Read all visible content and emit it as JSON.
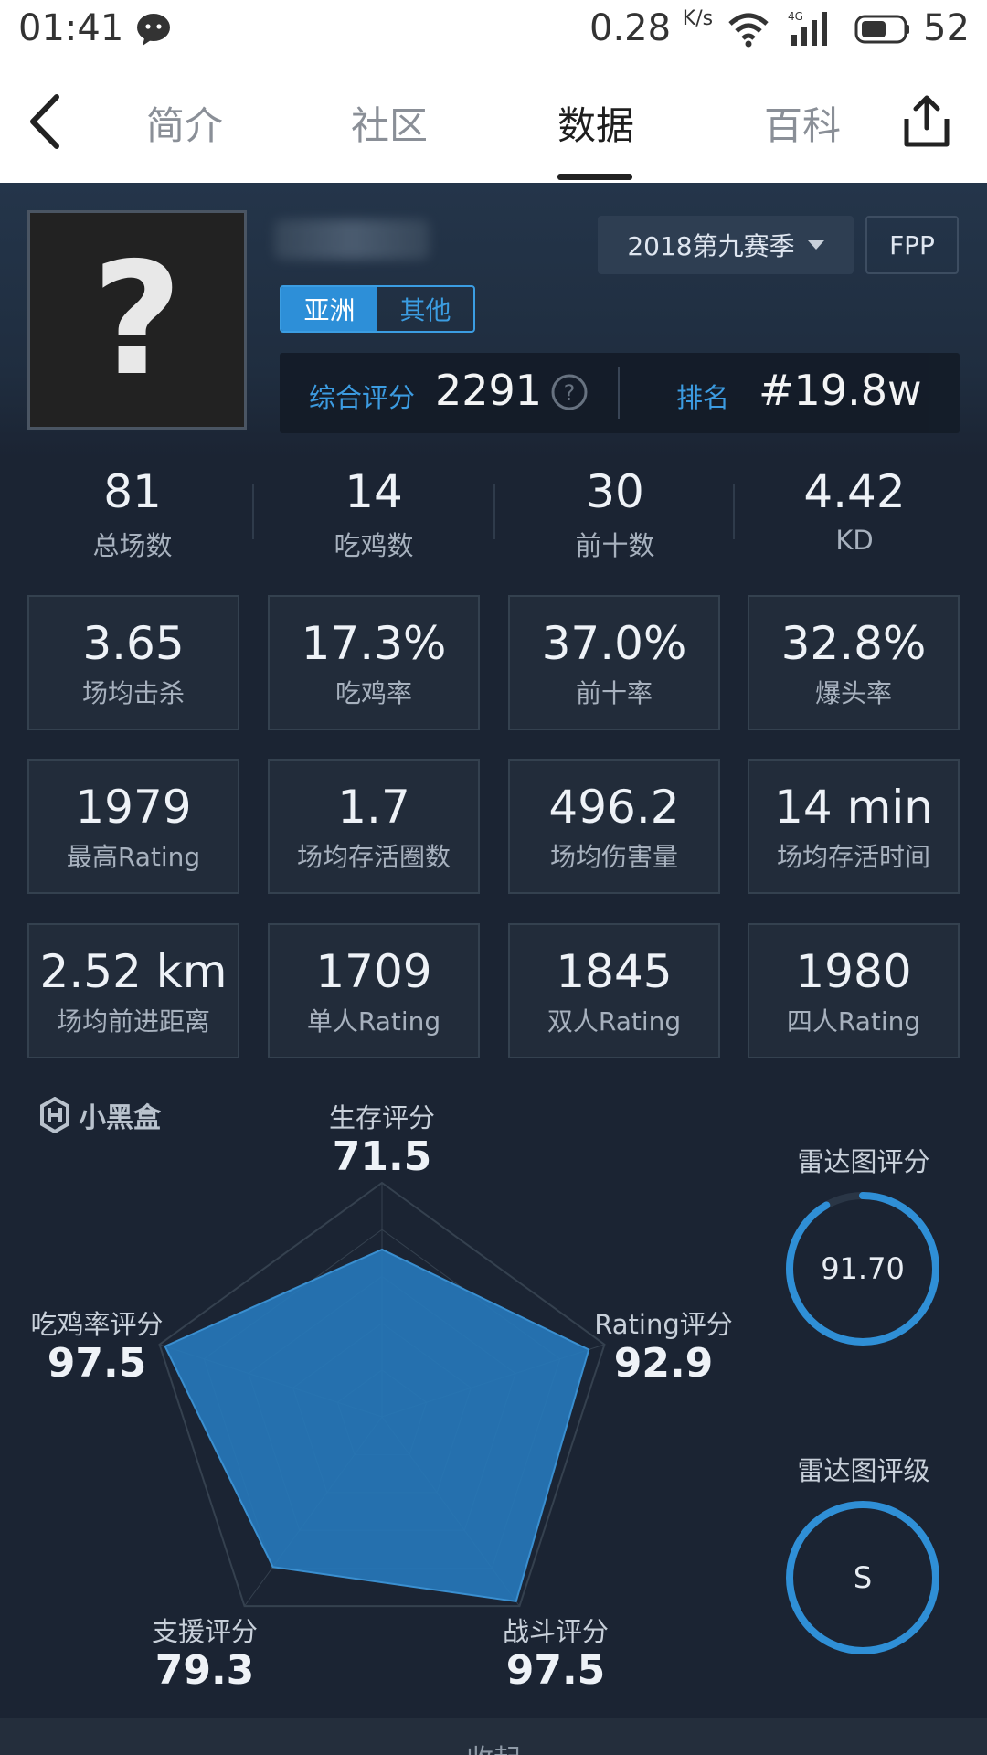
{
  "status_bar": {
    "time": "01:41",
    "net_speed": "0.28",
    "net_unit": "K/s",
    "battery": "52"
  },
  "nav": {
    "tabs": [
      {
        "label": "简介"
      },
      {
        "label": "社区"
      },
      {
        "label": "数据"
      },
      {
        "label": "百科"
      }
    ],
    "active_tab": "数据"
  },
  "profile": {
    "season": "2018第九赛季",
    "mode": "FPP",
    "regions": [
      "亚洲",
      "其他"
    ],
    "score_label": "综合评分",
    "score": "2291",
    "rank_label": "排名",
    "rank": "#19.8w"
  },
  "top_stats": [
    {
      "value": "81",
      "label": "总场数"
    },
    {
      "value": "14",
      "label": "吃鸡数"
    },
    {
      "value": "30",
      "label": "前十数"
    },
    {
      "value": "4.42",
      "label": "KD"
    }
  ],
  "stat_cards": [
    {
      "value": "3.65",
      "label": "场均击杀"
    },
    {
      "value": "17.3%",
      "label": "吃鸡率"
    },
    {
      "value": "37.0%",
      "label": "前十率"
    },
    {
      "value": "32.8%",
      "label": "爆头率"
    },
    {
      "value": "1979",
      "label": "最高Rating"
    },
    {
      "value": "1.7",
      "label": "场均存活圈数"
    },
    {
      "value": "496.2",
      "label": "场均伤害量"
    },
    {
      "value": "14 min",
      "label": "场均存活时间"
    },
    {
      "value": "2.52 km",
      "label": "场均前进距离"
    },
    {
      "value": "1709",
      "label": "单人Rating"
    },
    {
      "value": "1845",
      "label": "双人Rating"
    },
    {
      "value": "1980",
      "label": "四人Rating"
    }
  ],
  "radar": {
    "brand": "小黑盒",
    "axes": [
      {
        "label": "生存评分",
        "value": "71.5"
      },
      {
        "label": "Rating评分",
        "value": "92.9"
      },
      {
        "label": "战斗评分",
        "value": "97.5"
      },
      {
        "label": "支援评分",
        "value": "79.3"
      },
      {
        "label": "吃鸡率评分",
        "value": "97.5"
      }
    ],
    "score_title": "雷达图评分",
    "score_value": "91.70",
    "score_fraction": 0.917,
    "grade_title": "雷达图评级",
    "grade_value": "S",
    "accent": "#2f8fd6"
  },
  "footer": {
    "collapse_label": "收起"
  }
}
